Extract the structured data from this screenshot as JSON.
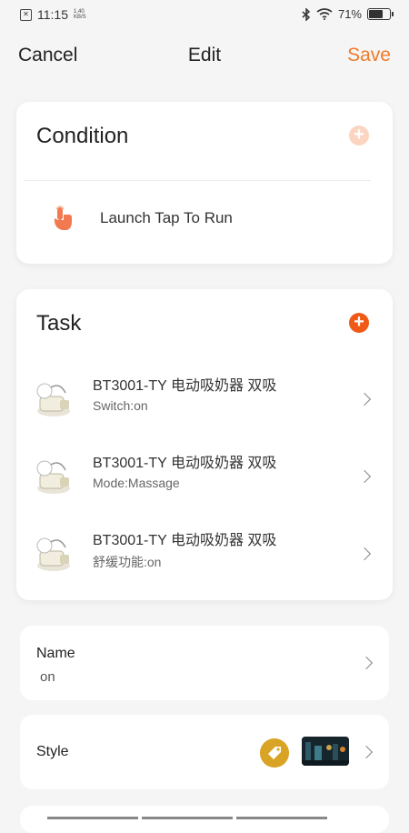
{
  "status_bar": {
    "time": "11:15",
    "net_speed_value": "1.40",
    "net_speed_unit": "KB/S",
    "battery_text": "71%",
    "battery_level": 0.71
  },
  "nav": {
    "cancel_label": "Cancel",
    "title": "Edit",
    "save_label": "Save"
  },
  "condition": {
    "title": "Condition",
    "add_symbol": "+",
    "item_label": "Launch Tap To Run"
  },
  "task": {
    "title": "Task",
    "add_symbol": "+",
    "items": [
      {
        "name": "BT3001-TY 电动吸奶器 双吸",
        "status": "Switch:on"
      },
      {
        "name": "BT3001-TY 电动吸奶器 双吸",
        "status": "Mode:Massage"
      },
      {
        "name": "BT3001-TY 电动吸奶器 双吸",
        "status": "舒缓功能:on"
      }
    ]
  },
  "name_setting": {
    "label": "Name",
    "value": "on"
  },
  "style_setting": {
    "label": "Style"
  },
  "colors": {
    "accent": "#f07a2a",
    "add_active": "#f05a16",
    "add_disabled": "#fbd5c2",
    "tag": "#d9a425"
  }
}
